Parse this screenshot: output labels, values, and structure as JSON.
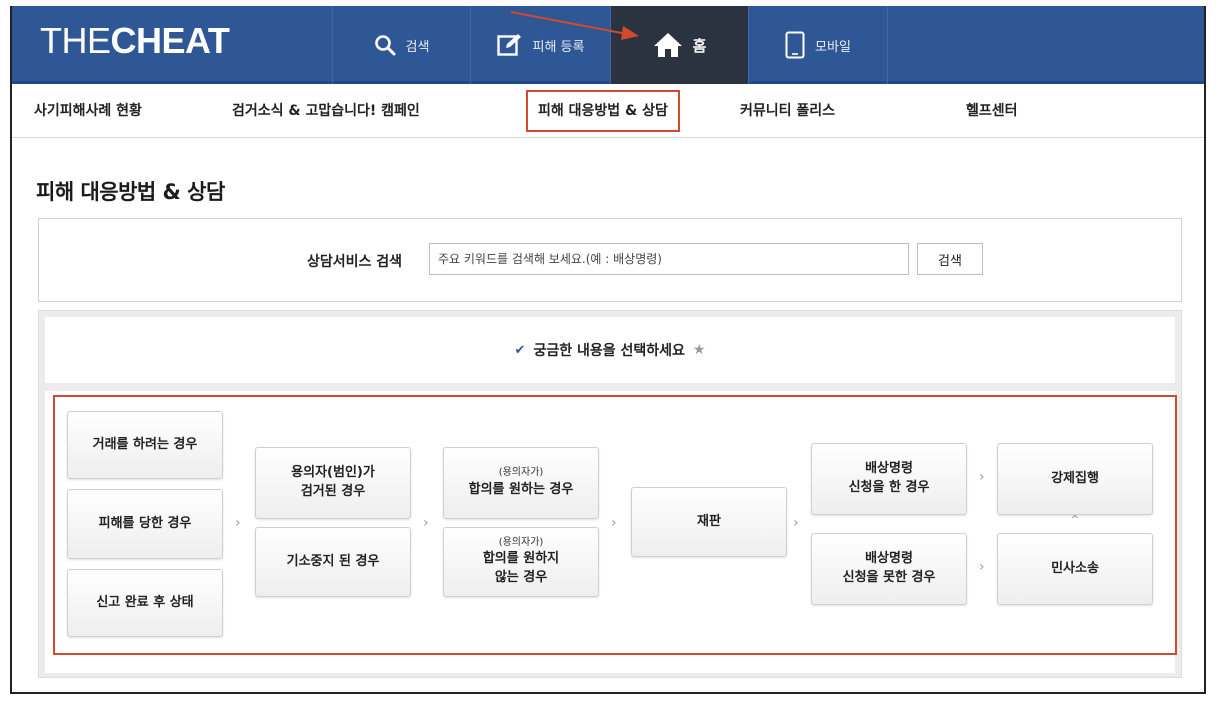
{
  "brand": {
    "logo_light": "THE",
    "logo_bold": "CHEAT"
  },
  "top_nav": {
    "search": "검색",
    "report": "피해 등록",
    "home": "홈",
    "mobile": "모바일"
  },
  "sub_nav": [
    "사기피해사례 현황",
    "검거소식 & 고맙습니다! 캠페인",
    "피해 대응방법 & 상담",
    "커뮤니티 폴리스",
    "헬프센터"
  ],
  "page": {
    "title": "피해 대응방법 & 상담"
  },
  "search": {
    "label": "상담서비스 검색",
    "placeholder": "주요 키워드를 검색해 보세요.(예 : 배상명령)",
    "button": "검색"
  },
  "select": {
    "title": "궁금한 내용을 선택하세요"
  },
  "flow": {
    "col1": [
      "거래를 하려는 경우",
      "피해를 당한 경우",
      "신고 완료 후 상태"
    ],
    "suspect_caught": [
      "용의자(범인)가",
      "검거된 경우"
    ],
    "indicted_stopped": "기소중지 된 경우",
    "agree_small": "(용의자가)",
    "agree_main": "합의를 원하는 경우",
    "disagree_small": "(용의자가)",
    "disagree_main": [
      "합의를 원하지",
      "않는 경우"
    ],
    "trial": "재판",
    "comp_filed": [
      "배상명령",
      "신청을 한 경우"
    ],
    "comp_not_filed": [
      "배상명령",
      "신청을 못한 경우"
    ],
    "enforcement": "강제집행",
    "civil_suit": "민사소송"
  },
  "colors": {
    "nav_bg": "#2f5795",
    "active_tab": "#2b3340",
    "highlight": "#d04a30"
  },
  "icons": [
    "search-icon",
    "edit-icon",
    "home-icon",
    "mobile-icon",
    "check-icon",
    "star-icon",
    "chevron-right-icon",
    "chevron-up-icon"
  ]
}
